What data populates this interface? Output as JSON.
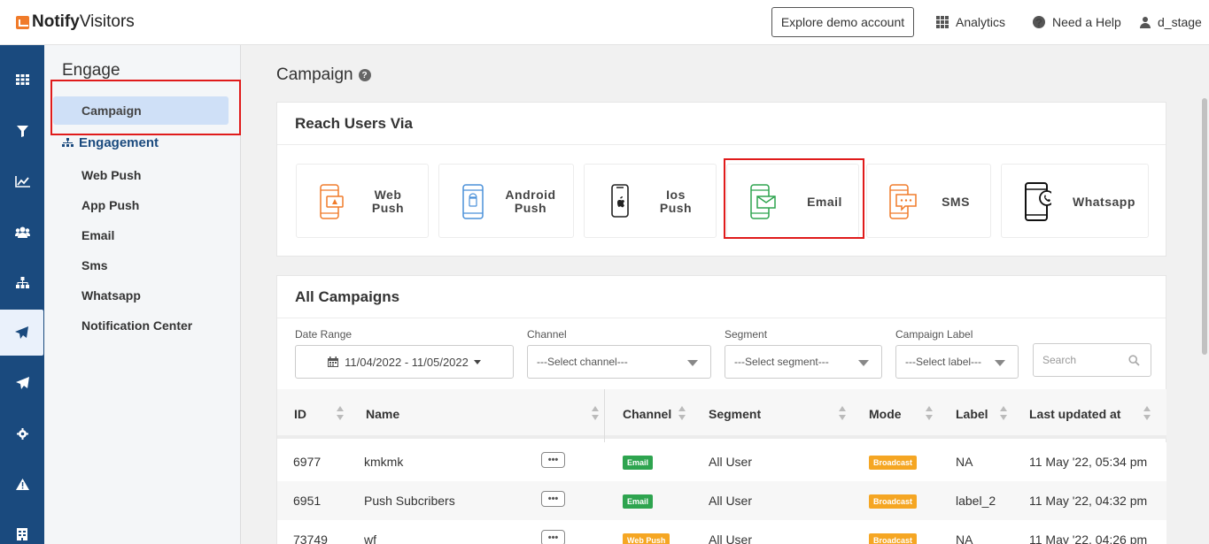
{
  "header": {
    "logo_bold": "Notify",
    "logo_rest": "Visitors",
    "demo_button": "Explore demo account",
    "analytics": "Analytics",
    "help": "Need a Help",
    "user": "d_stage"
  },
  "rail": {
    "icons": [
      "dashboard-icon",
      "filter-icon",
      "chart-icon",
      "users-icon",
      "sitemap-icon",
      "campaign-icon",
      "send-icon",
      "settings-icon",
      "warning-icon",
      "report-icon"
    ],
    "active_index": 5
  },
  "submenu": {
    "title": "Engage",
    "active_item": "Campaign",
    "group": "Engagement",
    "items": [
      "Web Push",
      "App Push",
      "Email",
      "Sms",
      "Whatsapp",
      "Notification Center"
    ]
  },
  "page": {
    "title": "Campaign",
    "reach_title": "Reach Users Via",
    "channels": [
      {
        "line1": "Web",
        "line2": "Push",
        "color": "#f07b2a"
      },
      {
        "line1": "Android",
        "line2": "Push",
        "color": "#4a90d9"
      },
      {
        "line1": "Ios",
        "line2": "Push",
        "color": "#222222"
      },
      {
        "line1": "Email",
        "line2": "",
        "color": "#2ea44f"
      },
      {
        "line1": "SMS",
        "line2": "",
        "color": "#f07b2a"
      },
      {
        "line1": "Whatsapp",
        "line2": "",
        "color": "#111111"
      }
    ],
    "all_title": "All Campaigns"
  },
  "filters": {
    "date_label": "Date Range",
    "date_value": "11/04/2022 - 11/05/2022",
    "channel_label": "Channel",
    "channel_value": "---Select channel---",
    "segment_label": "Segment",
    "segment_value": "---Select segment---",
    "label_label": "Campaign Label",
    "label_value": "---Select label---",
    "search_placeholder": "Search"
  },
  "table": {
    "columns": [
      "ID",
      "Name",
      "Channel",
      "Segment",
      "Mode",
      "Label",
      "Last updated at"
    ],
    "rows": [
      {
        "id": "6977",
        "name": "kmkmk",
        "channel": "Email",
        "segment": "All User",
        "mode": "Broadcast",
        "label": "NA",
        "updated": "11 May '22, 05:34 pm"
      },
      {
        "id": "6951",
        "name": "Push Subcribers",
        "channel": "Email",
        "segment": "All User",
        "mode": "Broadcast",
        "label": "label_2",
        "updated": "11 May '22, 04:32 pm"
      },
      {
        "id": "73749",
        "name": "wf",
        "channel": "Web Push",
        "segment": "All User",
        "mode": "Broadcast",
        "label": "NA",
        "updated": "11 May '22, 04:26 pm"
      }
    ]
  },
  "colors": {
    "rail": "#1a4a7e",
    "highlight": "#e01b1b",
    "email_badge": "#2ea44f",
    "broadcast_badge": "#f5a623"
  }
}
